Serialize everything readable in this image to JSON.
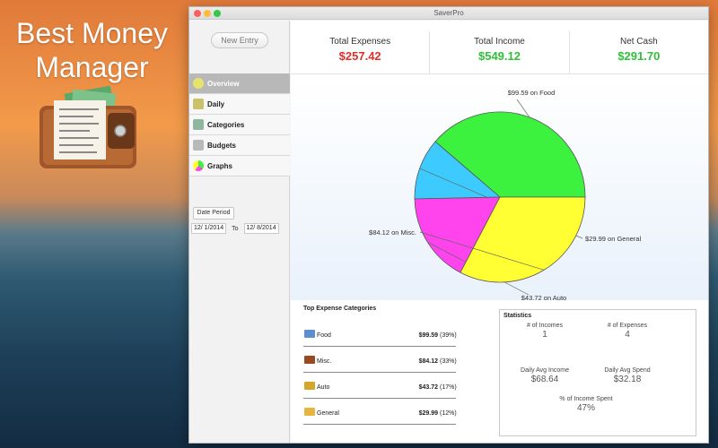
{
  "promo": {
    "line1": "Best Money",
    "line2": "Manager"
  },
  "window": {
    "title": "SaverPro"
  },
  "sidebar": {
    "new_entry_label": "New Entry",
    "items": [
      {
        "label": "Overview",
        "icon": "lightbulb-icon",
        "active": true
      },
      {
        "label": "Daily",
        "icon": "calendar-icon",
        "active": false
      },
      {
        "label": "Categories",
        "icon": "tag-icon",
        "active": false
      },
      {
        "label": "Budgets",
        "icon": "ledger-icon",
        "active": false
      },
      {
        "label": "Graphs",
        "icon": "pie-chart-icon",
        "active": false
      }
    ],
    "date_period_label": "Date Period",
    "date_from": "12/  1/2014",
    "date_to_label": "To",
    "date_to": "12/  8/2014"
  },
  "summary": {
    "expenses": {
      "label": "Total Expenses",
      "value": "$257.42",
      "color": "#e0302b"
    },
    "income": {
      "label": "Total Income",
      "value": "$549.12",
      "color": "#2fbf3a"
    },
    "net": {
      "label": "Net Cash",
      "value": "$291.70",
      "color": "#2fbf3a"
    }
  },
  "chart_data": {
    "type": "pie",
    "slices": [
      {
        "label": "$99.59 on Food",
        "value": 99.59,
        "color": "#3cf23f"
      },
      {
        "label": "$29.99 on General",
        "value": 29.99,
        "color": "#3dcbff"
      },
      {
        "label": "$43.72 on Auto",
        "value": 43.72,
        "color": "#ff44ee"
      },
      {
        "label": "$84.12 on Misc.",
        "value": 84.12,
        "color": "#ffff33"
      }
    ]
  },
  "top_expenses": {
    "title": "Top Expense Categories",
    "rows": [
      {
        "name": "Food",
        "amount": "$99.59",
        "percent": "(39%)",
        "icon": "basket-icon",
        "color": "#5b8fd0"
      },
      {
        "name": "Misc.",
        "amount": "$84.12",
        "percent": "(33%)",
        "icon": "wallet-icon",
        "color": "#9a4a22"
      },
      {
        "name": "Auto",
        "amount": "$43.72",
        "percent": "(17%)",
        "icon": "car-icon",
        "color": "#d6a62a"
      },
      {
        "name": "General",
        "amount": "$29.99",
        "percent": "(12%)",
        "icon": "folder-icon",
        "color": "#e8b440"
      }
    ]
  },
  "statistics": {
    "title": "Statistics",
    "incomes_label": "# of Incomes",
    "incomes_value": "1",
    "expenses_label": "# of Expenses",
    "expenses_value": "4",
    "avg_income_label": "Daily Avg Income",
    "avg_income_value": "$68.64",
    "avg_spend_label": "Daily Avg Spend",
    "avg_spend_value": "$32.18",
    "pct_spent_label": "% of Income Spent",
    "pct_spent_value": "47%"
  }
}
